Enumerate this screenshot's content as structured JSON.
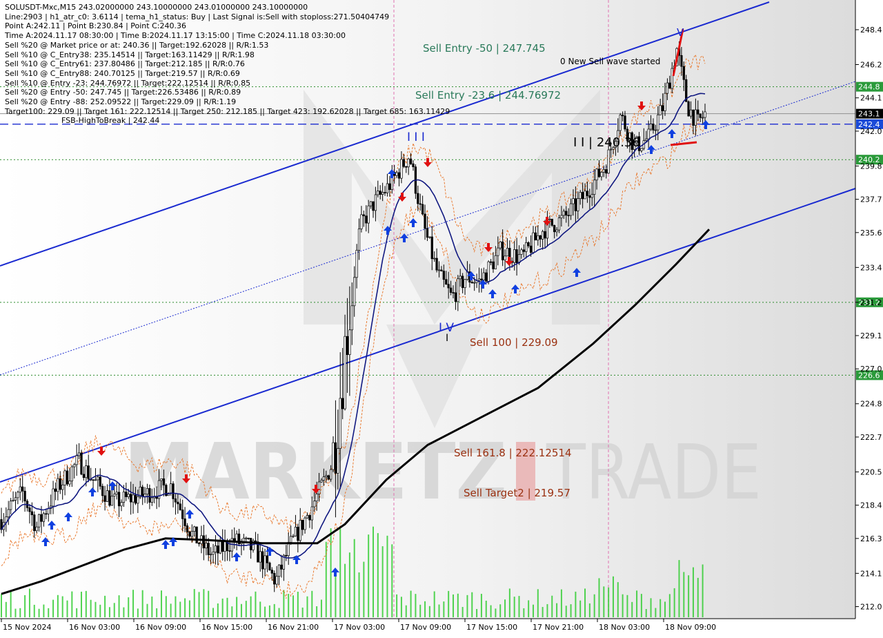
{
  "header": {
    "lines": [
      "SOLUSDT-Mxc,M15  243.02000000 243.10000000 243.01000000 243.10000000",
      "Line:2903 | h1_atr_c0: 3.6114 | tema_h1_status: Buy | Last Signal is:Sell with stoploss:271.50404749",
      "Point A:242.11 | Point B:230.84 | Point C:240.36",
      "Time A:2024.11.17 08:30:00 | Time B:2024.11.17 13:15:00 | Time C:2024.11.18 03:30:00",
      "Sell %20 @ Market price or at: 240.36 || Target:192.62028 || R/R:1.53",
      "Sell %10 @ C_Entry38: 235.14514 || Target:163.11429 || R/R:1.98",
      "Sell %10 @ C_Entry61: 237.80486 || Target:212.185 || R/R:0.76",
      "Sell %10 @ C_Entry88: 240.70125 || Target:219.57 || R/R:0.69",
      "Sell %10 @ Entry -23: 244.76972 || Target:222.12514 || R/R:0.85",
      "Sell %20 @ Entry -50: 247.745 || Target:226.53486 || R/R:0.89",
      "Sell %20 @ Entry -88: 252.09522 || Target:229.09 || R/R:1.19",
      "Target100: 229.09 || Target 161: 222.12514 || Target 250: 212.185 || Target 423: 192.62028 || Target 685: 163.11429"
    ]
  },
  "annotations": {
    "sell_entry_50": "Sell Entry -50 | 247.745",
    "new_sell_wave": "0 New Sell wave started",
    "sell_entry_236": "Sell Entry -23.6 | 244.76972",
    "fsb": "FSB-HighToBreak | 242.44",
    "point_c": "I I | 240.36",
    "point_a": "I I I",
    "point_b": "I V",
    "point_b_low": "I",
    "point_top": "V",
    "sell_100": "Sell 100 | 229.09",
    "sell_1618": "Sell 161.8 | 222.12514",
    "sell_target2": "Sell Target2 | 219.57"
  },
  "watermark": {
    "left": "MARKETZ",
    "right": "TRADE"
  },
  "colors": {
    "channel": "#1a2ad0",
    "ma_fast": "#101880",
    "ma_slow": "#000000",
    "bands": "#e87020",
    "volume": "#33cc33",
    "level_green": "#2a8a2a",
    "fsb": "#1a2ad0",
    "arrow_up": "#1040e0",
    "arrow_down": "#e01010",
    "vline": "#e070b0",
    "label_dark_red": "#9a3010",
    "label_green": "#2a7a5a"
  },
  "chart_data": {
    "type": "candlestick",
    "symbol": "SOLUSDT-Mxc",
    "timeframe": "M15",
    "ylim": [
      211.3,
      249.6
    ],
    "y_ticks": [
      {
        "label": "248.4",
        "value": 248.4
      },
      {
        "label": "246.2",
        "value": 246.2
      },
      {
        "label": "244.1",
        "value": 244.1
      },
      {
        "label": "242.0",
        "value": 242.0
      },
      {
        "label": "239.8",
        "value": 239.8
      },
      {
        "label": "237.7",
        "value": 237.7
      },
      {
        "label": "235.6",
        "value": 235.6
      },
      {
        "label": "233.4",
        "value": 233.4
      },
      {
        "label": "231.2",
        "value": 231.2
      },
      {
        "label": "229.1",
        "value": 229.1
      },
      {
        "label": "227.0",
        "value": 227.0
      },
      {
        "label": "224.8",
        "value": 224.8
      },
      {
        "label": "222.7",
        "value": 222.7
      },
      {
        "label": "220.5",
        "value": 220.5
      },
      {
        "label": "218.4",
        "value": 218.4
      },
      {
        "label": "216.3",
        "value": 216.3
      },
      {
        "label": "214.1",
        "value": 214.1
      },
      {
        "label": "212.0",
        "value": 212.0
      }
    ],
    "x_ticks": [
      "15 Nov 2024",
      "16 Nov 03:00",
      "16 Nov 09:00",
      "16 Nov 15:00",
      "16 Nov 21:00",
      "17 Nov 03:00",
      "17 Nov 09:00",
      "17 Nov 15:00",
      "17 Nov 21:00",
      "18 Nov 03:00",
      "18 Nov 09:00"
    ],
    "levels": [
      {
        "value": 244.8,
        "label": "244.8",
        "style": "dotted-green"
      },
      {
        "value": 243.1,
        "label": "243.1",
        "style": "current-price"
      },
      {
        "value": 242.44,
        "label": "242.4",
        "style": "dashed-blue"
      },
      {
        "value": 240.2,
        "label": "240.2",
        "style": "dotted-green"
      },
      {
        "value": 231.2,
        "label": "231.2",
        "style": "dotted-green"
      },
      {
        "value": 226.6,
        "label": "226.6",
        "style": "dotted-green"
      }
    ],
    "price_path": [
      {
        "t": 0,
        "p": 217.5
      },
      {
        "t": 0.03,
        "p": 219.2
      },
      {
        "t": 0.05,
        "p": 217.0
      },
      {
        "t": 0.08,
        "p": 219.5
      },
      {
        "t": 0.11,
        "p": 221.2
      },
      {
        "t": 0.13,
        "p": 220.0
      },
      {
        "t": 0.16,
        "p": 218.6
      },
      {
        "t": 0.2,
        "p": 219.0
      },
      {
        "t": 0.24,
        "p": 219.7
      },
      {
        "t": 0.27,
        "p": 216.6
      },
      {
        "t": 0.3,
        "p": 215.2
      },
      {
        "t": 0.33,
        "p": 216.2
      },
      {
        "t": 0.36,
        "p": 215.6
      },
      {
        "t": 0.39,
        "p": 213.6
      },
      {
        "t": 0.41,
        "p": 215.8
      },
      {
        "t": 0.44,
        "p": 218.2
      },
      {
        "t": 0.47,
        "p": 221.0
      },
      {
        "t": 0.49,
        "p": 229.0
      },
      {
        "t": 0.51,
        "p": 236.0
      },
      {
        "t": 0.53,
        "p": 237.5
      },
      {
        "t": 0.55,
        "p": 238.5
      },
      {
        "t": 0.58,
        "p": 240.5
      },
      {
        "t": 0.6,
        "p": 236.0
      },
      {
        "t": 0.62,
        "p": 233.0
      },
      {
        "t": 0.64,
        "p": 231.5
      },
      {
        "t": 0.66,
        "p": 232.8
      },
      {
        "t": 0.68,
        "p": 232.5
      },
      {
        "t": 0.71,
        "p": 234.5
      },
      {
        "t": 0.74,
        "p": 234.0
      },
      {
        "t": 0.77,
        "p": 235.8
      },
      {
        "t": 0.8,
        "p": 236.5
      },
      {
        "t": 0.83,
        "p": 238.0
      },
      {
        "t": 0.86,
        "p": 240.0
      },
      {
        "t": 0.88,
        "p": 243.0
      },
      {
        "t": 0.9,
        "p": 241.0
      },
      {
        "t": 0.92,
        "p": 241.6
      },
      {
        "t": 0.94,
        "p": 243.5
      },
      {
        "t": 0.96,
        "p": 247.2
      },
      {
        "t": 0.975,
        "p": 243.6
      },
      {
        "t": 0.99,
        "p": 242.5
      },
      {
        "t": 1.0,
        "p": 243.1
      }
    ]
  }
}
